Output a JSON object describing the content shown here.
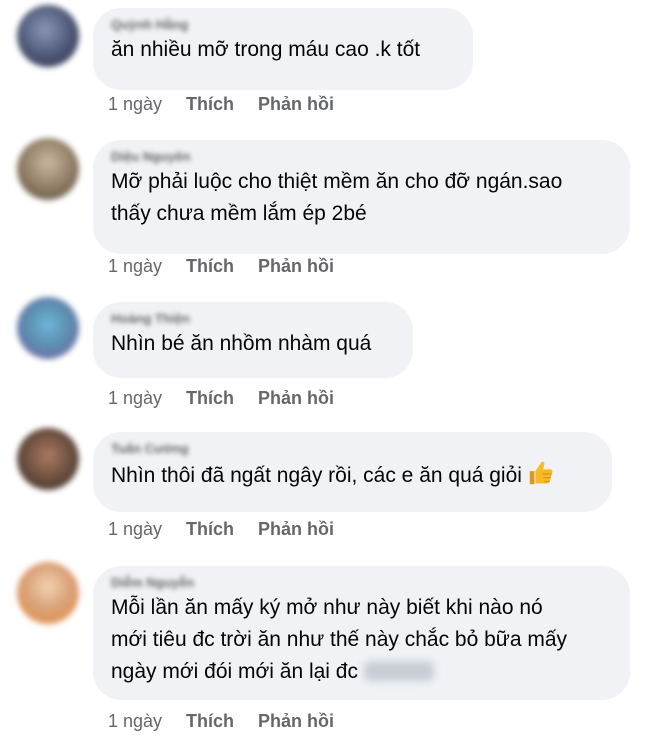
{
  "comments": [
    {
      "author": "Quỳnh Hằng",
      "text": "ăn nhiều mỡ trong máu cao .k tốt",
      "time": "1 ngày",
      "like": "Thích",
      "reply": "Phản hồi"
    },
    {
      "author": "Diệu Nguyên",
      "text": "Mỡ phải luộc cho thiệt mềm ăn cho đỡ ngán.sao\nthấy chưa mềm lắm ép 2bé",
      "time": "1 ngày",
      "like": "Thích",
      "reply": "Phản hồi"
    },
    {
      "author": "Hoàng Thiện",
      "text": "Nhìn bé ăn nhồm nhàm quá",
      "time": "1 ngày",
      "like": "Thích",
      "reply": "Phản hồi"
    },
    {
      "author": "Tuấn Cường",
      "text": "Nhìn thôi đã ngất ngây rồi, các e ăn quá giỏi",
      "time": "1 ngày",
      "like": "Thích",
      "reply": "Phản hồi"
    },
    {
      "author": "Diễm Nguyễn",
      "text": "Mỗi lần ăn mấy ký mở như này biết khi nào nó\nmới tiêu đc trời ăn như thế này chắc bỏ bữa mấy\nngày mới đói mới ăn lại đc",
      "time": "1 ngày",
      "like": "Thích",
      "reply": "Phản hồi"
    }
  ],
  "colors": {
    "bubble": "#f0f2f5",
    "meta": "#65676b",
    "text": "#050505"
  },
  "icons": {
    "thumbs_up": "thumbs-up-emoji-icon"
  }
}
